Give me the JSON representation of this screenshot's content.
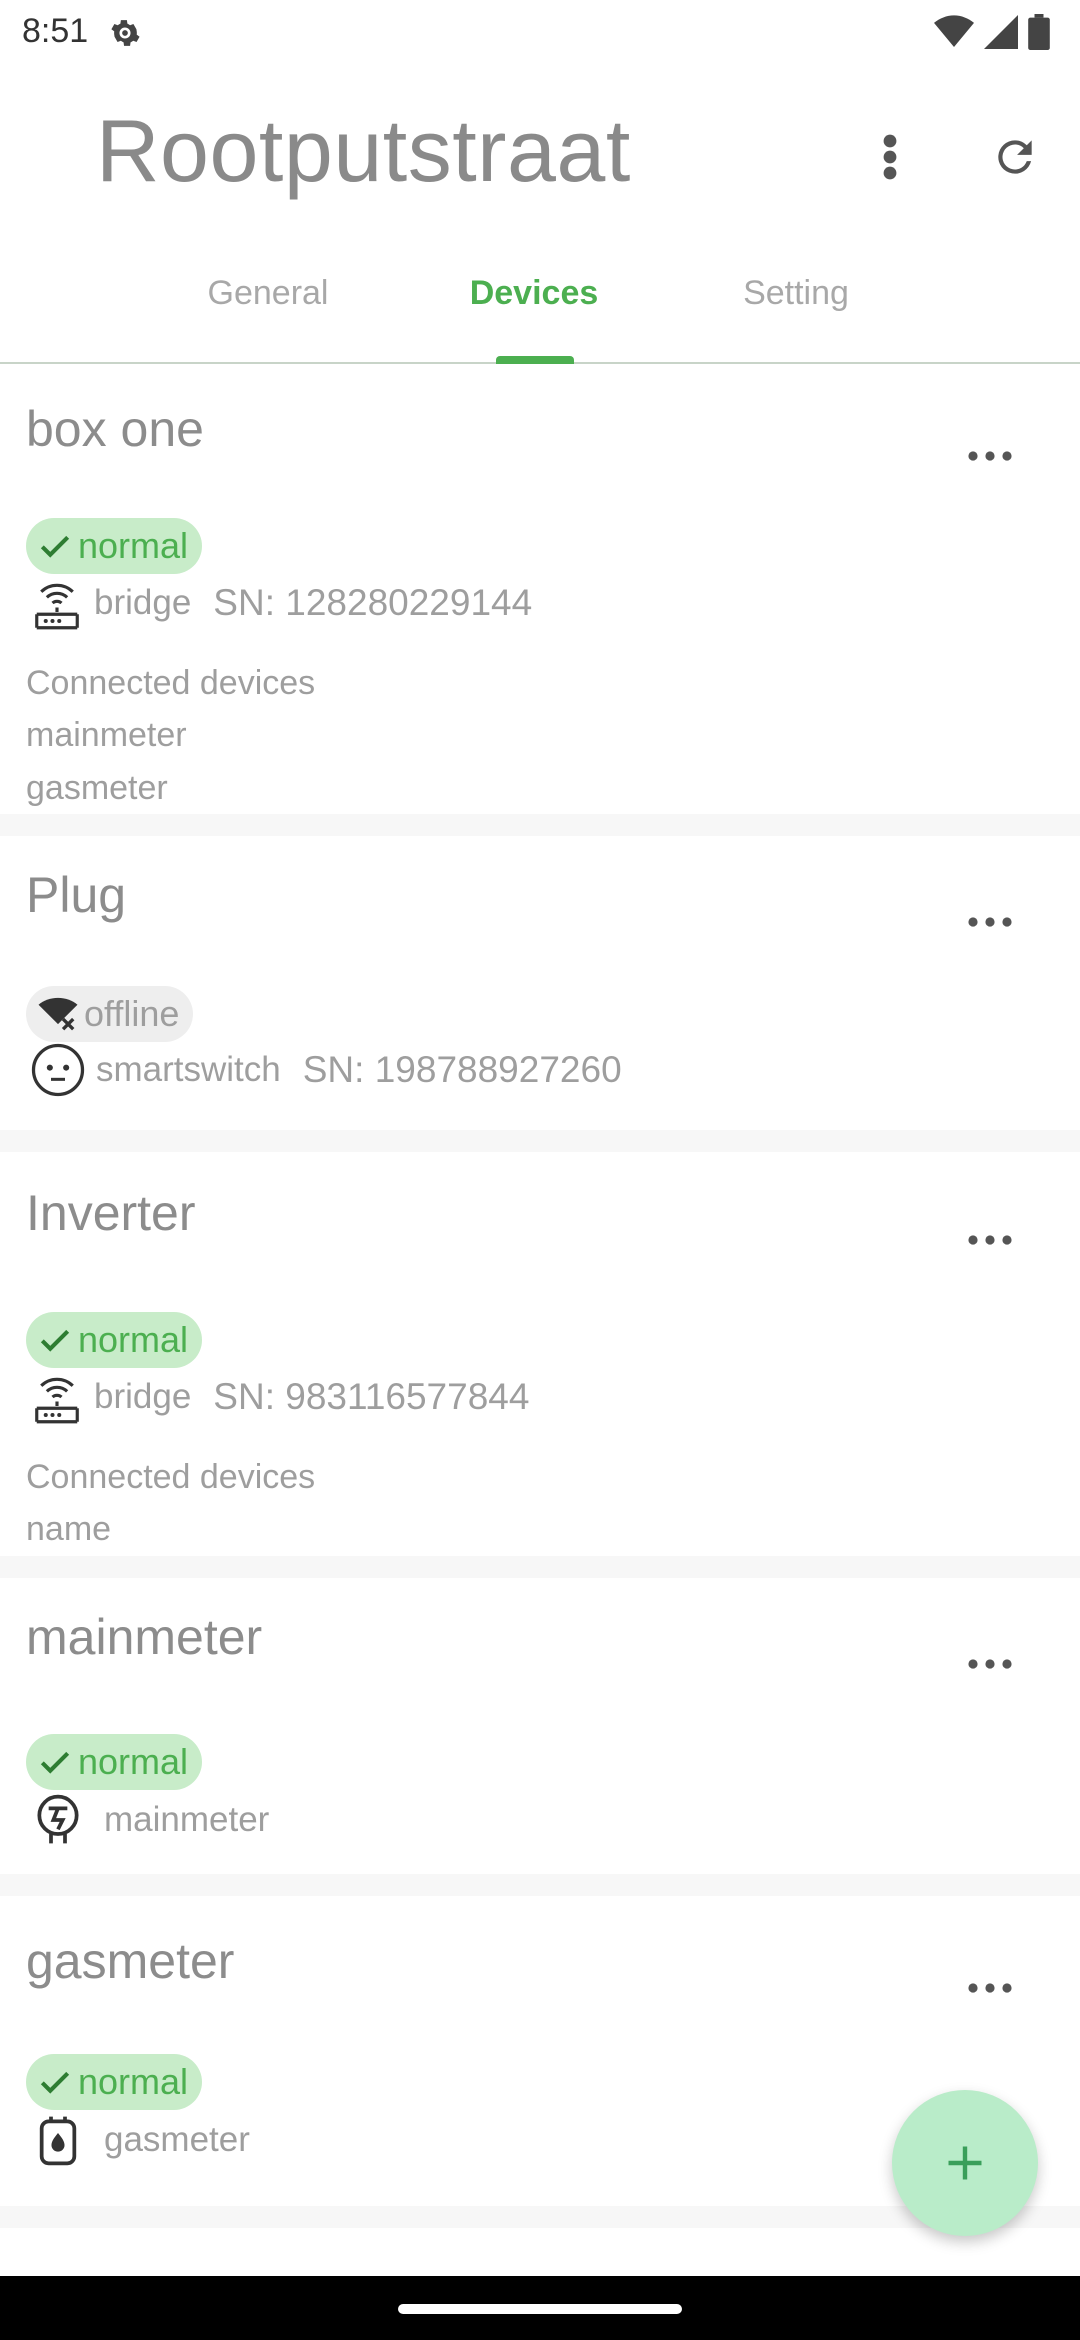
{
  "status_bar": {
    "time": "8:51",
    "icons": [
      "settings-gear-icon",
      "wifi-icon",
      "cell-signal-icon",
      "battery-icon"
    ]
  },
  "app_bar": {
    "title": "Rootputstraat",
    "more_icon": "more-vert-icon",
    "refresh_icon": "refresh-icon"
  },
  "tabs": [
    {
      "label": "General",
      "active": false
    },
    {
      "label": "Devices",
      "active": true
    },
    {
      "label": "Setting",
      "active": false
    }
  ],
  "colors": {
    "accent": "#4caf50",
    "badge_normal_bg": "#c8ecc9",
    "badge_offline_bg": "#eeeeee",
    "fab_bg": "#b9ecc9"
  },
  "devices": [
    {
      "name": "box one",
      "status": "normal",
      "type_icon": "bridge-router-icon",
      "type": "bridge",
      "sn": "SN: 128280229144",
      "connected_label": "Connected devices",
      "connected": [
        "mainmeter",
        "gasmeter"
      ]
    },
    {
      "name": "Plug",
      "status": "offline",
      "type_icon": "socket-plug-icon",
      "type": "smartswitch",
      "sn": "SN: 198788927260"
    },
    {
      "name": "Inverter",
      "status": "normal",
      "type_icon": "bridge-router-icon",
      "type": "bridge",
      "sn": "SN: 983116577844",
      "connected_label": "Connected devices",
      "connected": [
        "name"
      ]
    },
    {
      "name": "mainmeter",
      "status": "normal",
      "type_icon": "electric-meter-icon",
      "type": "mainmeter"
    },
    {
      "name": "gasmeter",
      "status": "normal",
      "type_icon": "gas-meter-icon",
      "type": "gasmeter"
    }
  ],
  "fab": {
    "icon": "add-icon"
  }
}
